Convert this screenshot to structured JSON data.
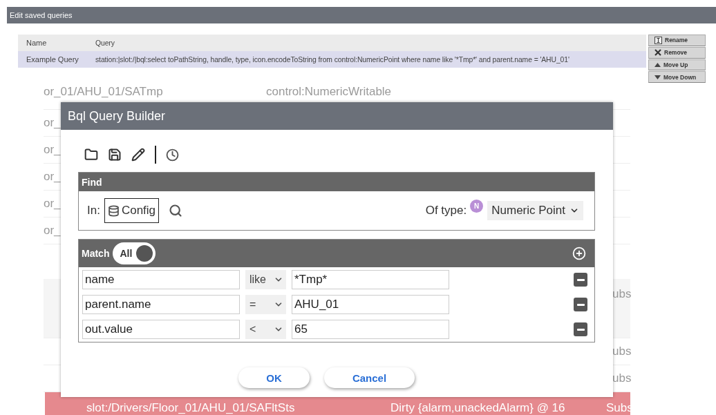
{
  "page": {
    "title": "Edit saved queries"
  },
  "saved_queries": {
    "columns": [
      "Name",
      "Query"
    ],
    "rows": [
      {
        "name": "Example Query",
        "query": "station:|slot:/|bql:select toPathString, handle, type, icon.encodeToString from control:NumericPoint where name like '*Tmp*' and parent.name = 'AHU_01'",
        "selected": true
      }
    ]
  },
  "side_buttons": [
    {
      "label": "Rename",
      "kind": "rename"
    },
    {
      "label": "Remove",
      "kind": "remove"
    },
    {
      "label": "Move Up",
      "kind": "up"
    },
    {
      "label": "Move Down",
      "kind": "down"
    }
  ],
  "background_rows": [
    {
      "column_1": "or_01/AHU_01/SATmp",
      "column_2": "control:NumericWritable"
    },
    {
      "column_1": "or_"
    },
    {
      "column_1": "or_"
    },
    {
      "column_1": "or_"
    },
    {
      "column_1": "or_"
    },
    {
      "column_1": "or_"
    }
  ],
  "background_rows_lower": [
    {
      "column_3": "ubs"
    },
    {
      "column_3": "ubs"
    },
    {
      "column_3": "ubs"
    }
  ],
  "alarm_row": {
    "column_1": "slot:/Drivers/Floor_01/AHU_01/SAFltSts",
    "column_2": "Dirty {alarm,unackedAlarm} @ 16",
    "column_3": "Subs"
  },
  "dialog": {
    "title": "Bql Query Builder",
    "toolbar": [
      {
        "kind": "open"
      },
      {
        "kind": "save"
      },
      {
        "kind": "edit"
      },
      {
        "kind": "separator"
      },
      {
        "kind": "history"
      }
    ],
    "find": {
      "title": "Find",
      "in_label": "In:",
      "in_value": "Config",
      "type_label": "Of type:",
      "type_badge": "N",
      "type_value": "Numeric Point"
    },
    "match": {
      "title": "Match",
      "mode": "All",
      "rows": [
        {
          "field": "name",
          "operator": "like",
          "value": "*Tmp*"
        },
        {
          "field": "parent.name",
          "operator": "=",
          "value": "AHU_01"
        },
        {
          "field": "out.value",
          "operator": "<",
          "value": "65"
        }
      ]
    },
    "buttons": [
      "OK",
      "Cancel"
    ]
  }
}
